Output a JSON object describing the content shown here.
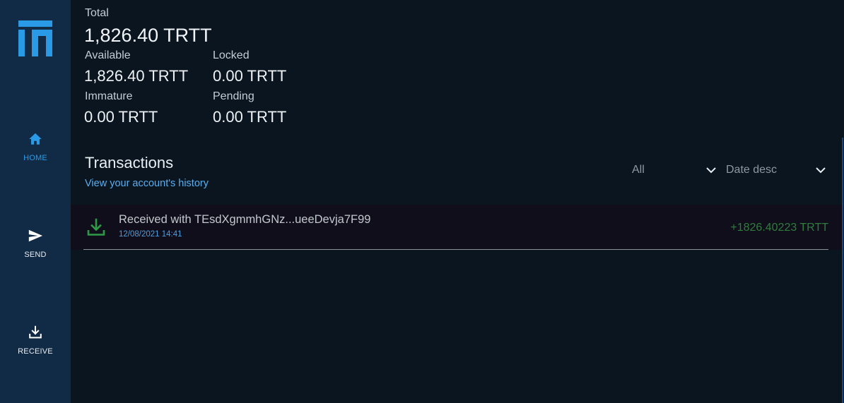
{
  "sidebar": {
    "logo_icon": "tt-logo-icon",
    "items": [
      {
        "label": "HOME",
        "icon": "home-icon",
        "active": true
      },
      {
        "label": "SEND",
        "icon": "send-icon",
        "active": false
      },
      {
        "label": "RECEIVE",
        "icon": "receive-icon",
        "active": false
      }
    ]
  },
  "balance": {
    "total_label": "Total",
    "total_value": "1,826.40 TRTT",
    "available_label": "Available",
    "available_value": "1,826.40 TRTT",
    "locked_label": "Locked",
    "locked_value": "0.00 TRTT",
    "immature_label": "Immature",
    "immature_value": "0.00 TRTT",
    "pending_label": "Pending",
    "pending_value": "0.00 TRTT"
  },
  "transactions": {
    "title": "Transactions",
    "subtitle": "View your account's history",
    "filter_type": "All",
    "filter_sort": "Date desc",
    "items": [
      {
        "icon": "download-icon",
        "description": "Received with TEsdXgmmhGNz...ueeDevja7F99",
        "date": "12/08/2021 14:41",
        "amount": "+1826.40223 TRTT"
      }
    ]
  },
  "colors": {
    "sidebar_bg": "#112a45",
    "main_bg": "#0a1520",
    "accent": "#2a9ae6",
    "link": "#5aaef0",
    "received": "#2f7d3c"
  }
}
